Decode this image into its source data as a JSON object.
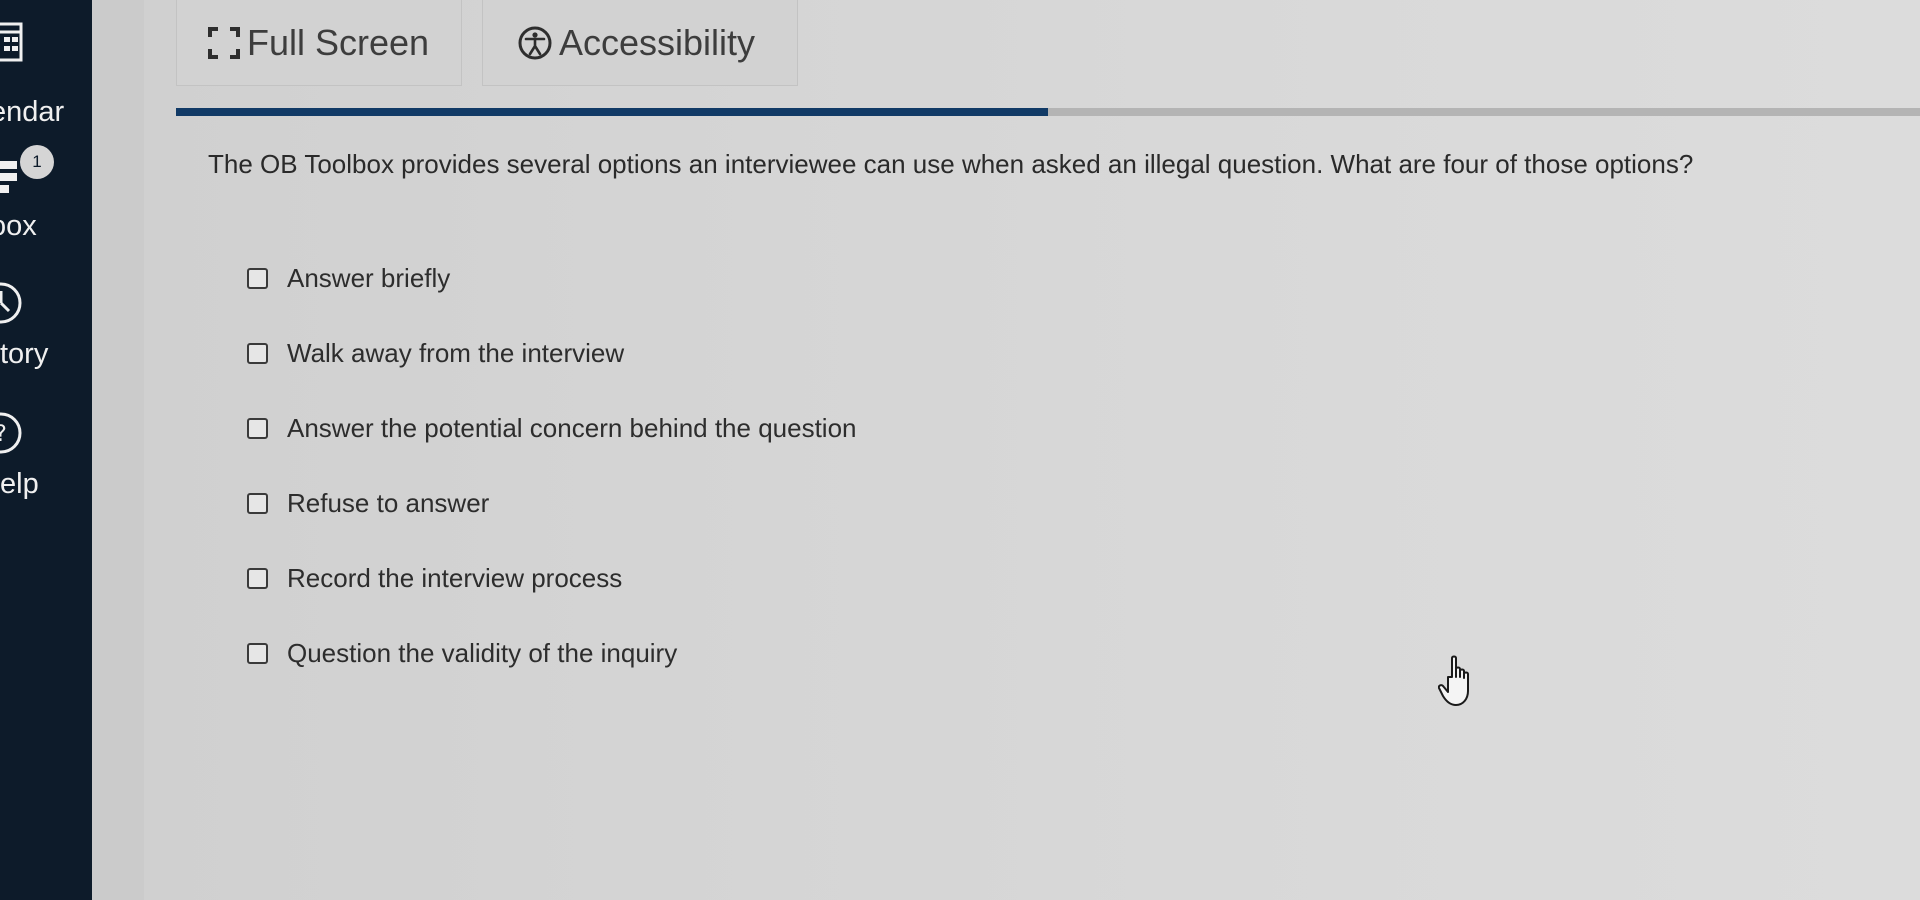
{
  "sidebar": {
    "items": [
      {
        "label": "endar",
        "icon": "calendar-icon"
      },
      {
        "label": "oox",
        "icon": "inbox-icon",
        "badge": "1"
      },
      {
        "label": "tory",
        "icon": "history-clock-icon"
      },
      {
        "label": "elp",
        "icon": "help-icon"
      }
    ]
  },
  "toolbar": {
    "fullscreen_label": "Full Screen",
    "fullscreen_icon": "fullscreen-icon",
    "accessibility_label": "Accessibility",
    "accessibility_icon": "accessibility-icon"
  },
  "progress": {
    "fraction": 0.5
  },
  "question": {
    "text": "The OB Toolbox provides several options an interviewee can use when asked an illegal question. What are four of those options?",
    "options": [
      {
        "label": "Answer briefly",
        "checked": false
      },
      {
        "label": "Walk away from the interview",
        "checked": false
      },
      {
        "label": "Answer the potential concern behind the question",
        "checked": false
      },
      {
        "label": "Refuse to answer",
        "checked": false
      },
      {
        "label": "Record the interview process",
        "checked": false
      },
      {
        "label": "Question the validity of the inquiry",
        "checked": false
      }
    ]
  },
  "colors": {
    "sidebar_bg": "#0d1b2a",
    "progress_fill": "#113a66",
    "progress_track": "#b4b4b4",
    "page_bg": "#d5d5d5"
  }
}
